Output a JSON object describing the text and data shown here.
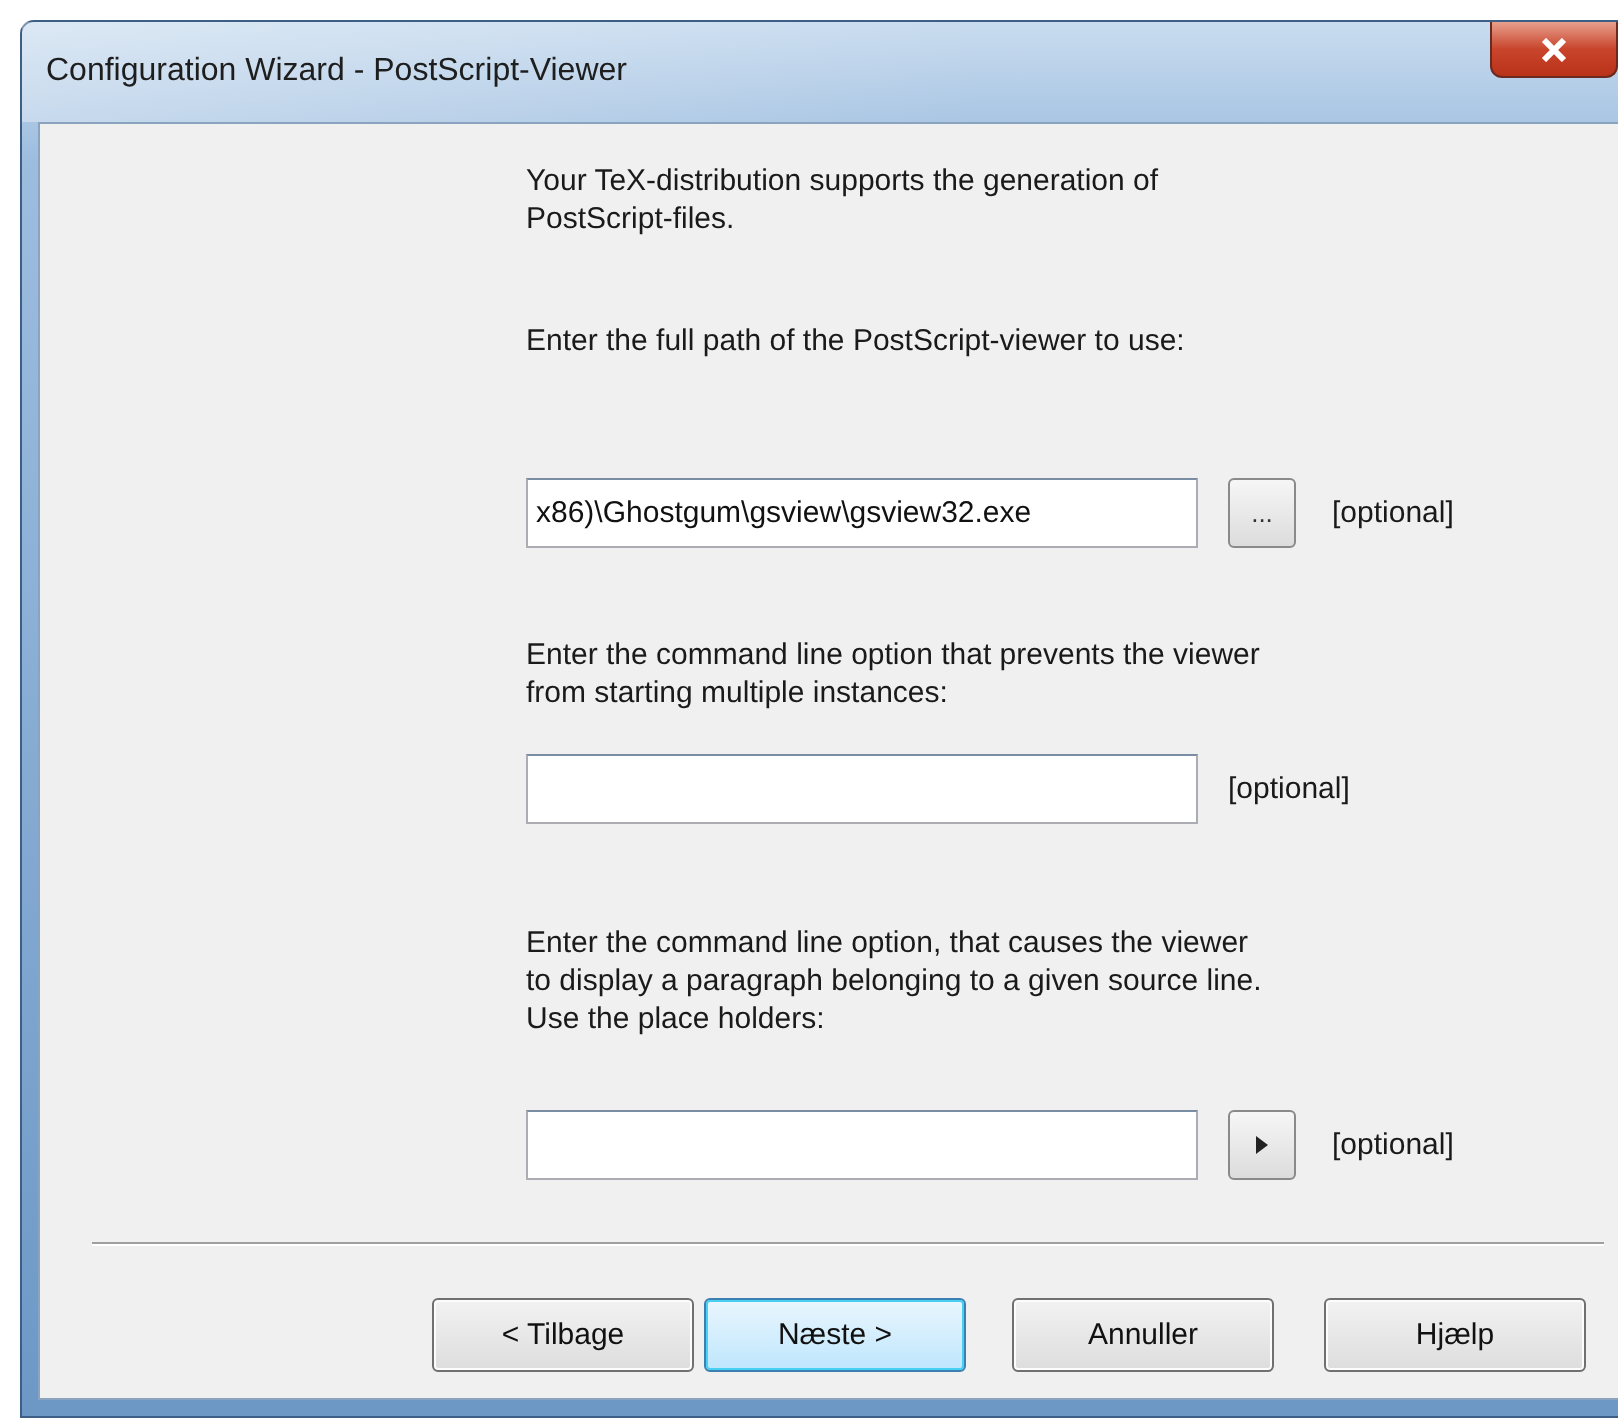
{
  "window": {
    "title": "Configuration Wizard - PostScript-Viewer"
  },
  "intro_lines": [
    "Your TeX-distribution supports the generation of",
    "PostScript-files."
  ],
  "first_label": "Enter the full path of the PostScript-viewer to use:",
  "fields": [
    {
      "kind": "browse",
      "value": "x86)\\Ghostgum\\gsview\\gsview32.exe",
      "button": "...",
      "note": "[optional]"
    },
    {
      "kind": "plain",
      "label_lines": [
        "Enter the command line option that prevents the viewer",
        "from starting multiple instances:"
      ],
      "note": "[optional]"
    },
    {
      "kind": "menu",
      "label_lines": [
        "Enter the command line option, that causes the viewer",
        "to display a paragraph belonging to a given source line.",
        "Use the place holders:"
      ],
      "note": "[optional]"
    }
  ],
  "buttons": [
    {
      "label": "< Tilbage",
      "default": false
    },
    {
      "label": "Næste >",
      "default": true
    },
    {
      "label": "Annuller",
      "default": false
    },
    {
      "label": "Hjælp",
      "default": false
    }
  ]
}
